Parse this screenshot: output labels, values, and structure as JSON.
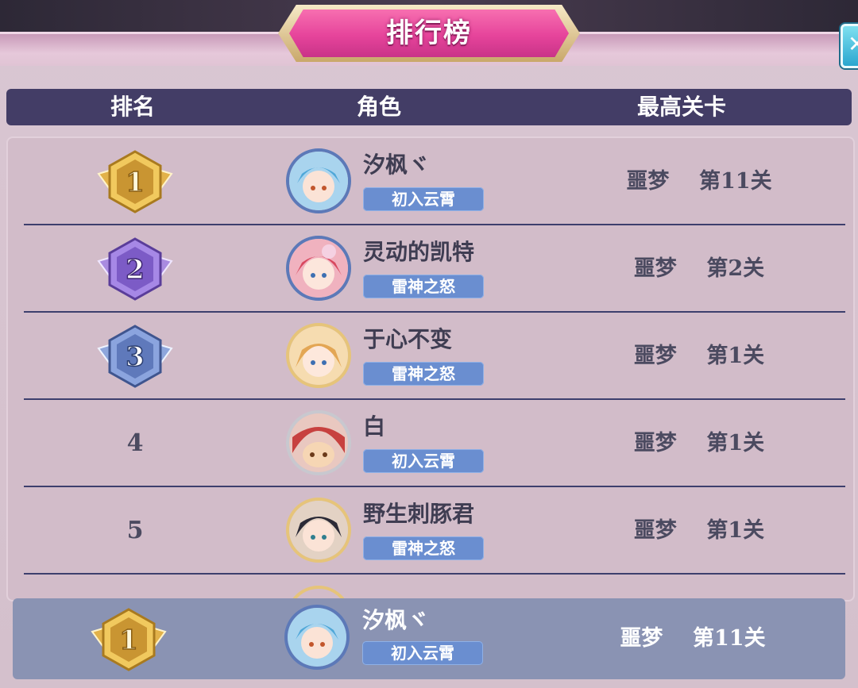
{
  "title": "排行榜",
  "columns": {
    "rank": "排名",
    "role": "角色",
    "stage": "最高关卡"
  },
  "rows": [
    {
      "rank": "1",
      "name": "汐枫ヾ",
      "title_tag": "初入云霄",
      "stage": "噩梦    第11关",
      "avatar": "blue-hair-character",
      "frame": "blue"
    },
    {
      "rank": "2",
      "name": "灵动的凯特",
      "title_tag": "雷神之怒",
      "stage": "噩梦    第2关",
      "avatar": "red-hair-character",
      "frame": "blue"
    },
    {
      "rank": "3",
      "name": "于心不变",
      "title_tag": "雷神之怒",
      "stage": "噩梦    第1关",
      "avatar": "blonde-character",
      "frame": "gold"
    },
    {
      "rank": "4",
      "name": "白",
      "title_tag": "初入云霄",
      "stage": "噩梦    第1关",
      "avatar": "red-hood-character",
      "frame": "silver"
    },
    {
      "rank": "5",
      "name": "野生刺豚君",
      "title_tag": "雷神之怒",
      "stage": "噩梦    第1关",
      "avatar": "dark-hair-character",
      "frame": "gold"
    }
  ],
  "my_rank": {
    "rank": "1",
    "name": "汐枫ヾ",
    "title_tag": "初入云霄",
    "stage": "噩梦    第11关"
  },
  "colors": {
    "header": "#433d66",
    "tag": "#6a8ed0",
    "banner": "#e6449b",
    "gold": "#e2b24a",
    "purple": "#8c6bd1",
    "blue": "#6a82c4"
  }
}
